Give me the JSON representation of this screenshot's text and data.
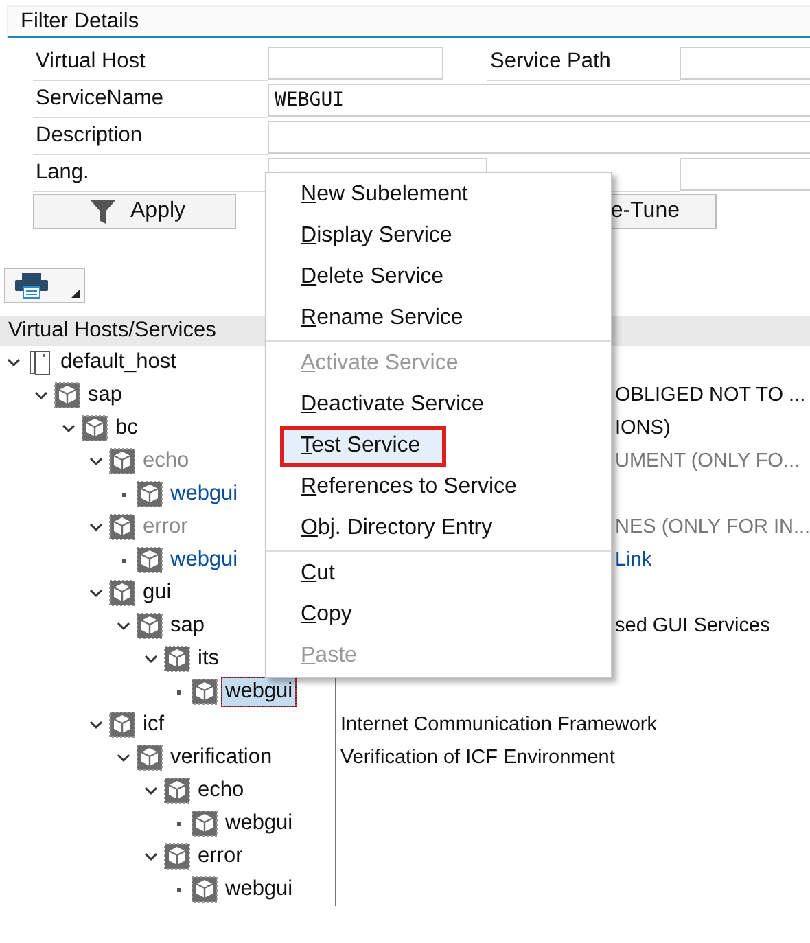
{
  "panel": {
    "title": "Filter Details"
  },
  "fields": [
    {
      "label": "Virtual Host",
      "kind": "short"
    },
    {
      "label": "Service Path",
      "kind": "short"
    },
    {
      "label": "ServiceName",
      "value": "WEBGUI",
      "kind": "wide"
    },
    {
      "label": "Description",
      "kind": "wide"
    },
    {
      "label": "Lang.",
      "kind": "select"
    },
    {
      "kind": "short"
    }
  ],
  "buttons": [
    {
      "label": "Apply",
      "kind": "filter"
    },
    {
      "label": "e-Tune",
      "kind": "plain"
    }
  ],
  "tree": {
    "header": "Virtual Hosts/Services",
    "nodes": [
      {
        "label": "default_host",
        "kind": "host",
        "expanded": true,
        "children": [
          {
            "label": "sap",
            "kind": "package",
            "expanded": true,
            "description": "OBLIGED NOT TO ...",
            "description_clipped": true,
            "children": [
              {
                "label": "bc",
                "kind": "package",
                "expanded": true,
                "description": "IONS)",
                "description_clipped": true,
                "children": [
                  {
                    "label": "echo",
                    "kind": "package",
                    "expanded": true,
                    "inactive": true,
                    "description": "UMENT (ONLY FO...",
                    "description_clipped": true,
                    "children": [
                      {
                        "label": "webgui",
                        "kind": "package",
                        "link": true
                      }
                    ]
                  },
                  {
                    "label": "error",
                    "kind": "package",
                    "expanded": true,
                    "inactive": true,
                    "description": "NES (ONLY FOR IN...",
                    "description_clipped": true,
                    "children": [
                      {
                        "label": "webgui",
                        "kind": "package",
                        "link": true,
                        "description": "Link",
                        "description_clipped": true
                      }
                    ]
                  },
                  {
                    "label": "gui",
                    "kind": "package",
                    "expanded": true,
                    "children": [
                      {
                        "label": "sap",
                        "kind": "package",
                        "expanded": true,
                        "description": "sed GUI Services",
                        "description_clipped": true,
                        "children": [
                          {
                            "label": "its",
                            "kind": "package",
                            "expanded": true,
                            "children": [
                              {
                                "label": "webgui",
                                "kind": "package",
                                "selected": true
                              }
                            ]
                          }
                        ]
                      }
                    ]
                  },
                  {
                    "label": "icf",
                    "kind": "package",
                    "expanded": true,
                    "description": "Internet Communication Framework",
                    "description_clipped": false,
                    "children": [
                      {
                        "label": "verification",
                        "kind": "package",
                        "expanded": true,
                        "description": "Verification of ICF Environment",
                        "description_clipped": false,
                        "children": [
                          {
                            "label": "echo",
                            "kind": "package",
                            "expanded": true,
                            "children": [
                              {
                                "label": "webgui",
                                "kind": "package"
                              }
                            ]
                          },
                          {
                            "label": "error",
                            "kind": "package",
                            "expanded": true,
                            "children": [
                              {
                                "label": "webgui",
                                "kind": "package"
                              }
                            ]
                          }
                        ]
                      }
                    ]
                  }
                ]
              }
            ]
          }
        ]
      }
    ]
  },
  "context_menu": {
    "groups": [
      [
        {
          "label": "New Subelement",
          "disabled": false,
          "selected": false
        },
        {
          "label": "Display Service",
          "disabled": false,
          "selected": false
        },
        {
          "label": "Delete Service",
          "disabled": false,
          "selected": false
        },
        {
          "label": "Rename Service",
          "disabled": false,
          "selected": false
        }
      ],
      [
        {
          "label": "Activate Service",
          "disabled": true,
          "selected": false
        },
        {
          "label": "Deactivate Service",
          "disabled": false,
          "selected": false
        },
        {
          "label": "Test Service",
          "disabled": false,
          "selected": true
        },
        {
          "label": "References to Service",
          "disabled": false,
          "selected": false
        },
        {
          "label": "Obj. Directory Entry",
          "disabled": false,
          "selected": false
        }
      ],
      [
        {
          "label": "Cut",
          "disabled": false,
          "selected": false
        },
        {
          "label": "Copy",
          "disabled": false,
          "selected": false
        },
        {
          "label": "Paste",
          "disabled": true,
          "selected": false
        }
      ]
    ]
  }
}
